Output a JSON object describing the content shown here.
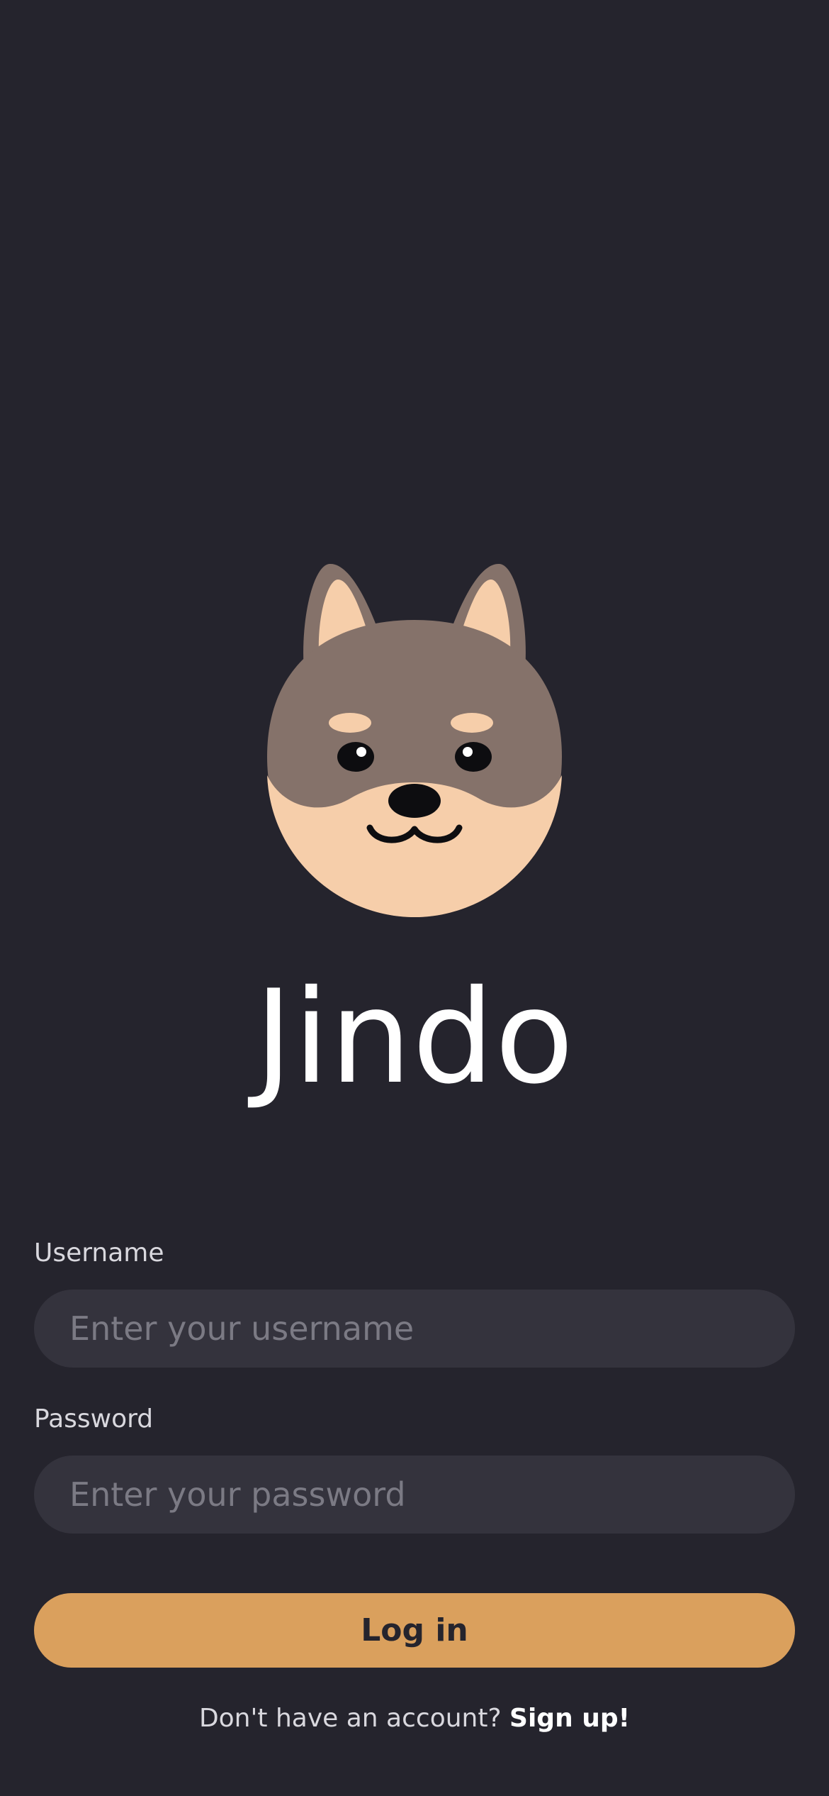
{
  "app": {
    "name": "Jindo",
    "logo_icon": "jindo-dog-icon"
  },
  "login_form": {
    "username_label": "Username",
    "username_placeholder": "Enter your username",
    "username_value": "",
    "password_label": "Password",
    "password_placeholder": "Enter your password",
    "password_value": "",
    "login_label": "Log in",
    "signup_prompt": "Don't have an account?",
    "signup_link": "Sign up!"
  },
  "colors": {
    "background": "#25242d",
    "input_background": "#34333d",
    "accent": "#daa05d",
    "text_primary": "#ffffff",
    "text_secondary": "#d9d8de",
    "placeholder": "#7b7a84",
    "dog_brown": "#85726a",
    "dog_tan": "#f6ceaa"
  }
}
